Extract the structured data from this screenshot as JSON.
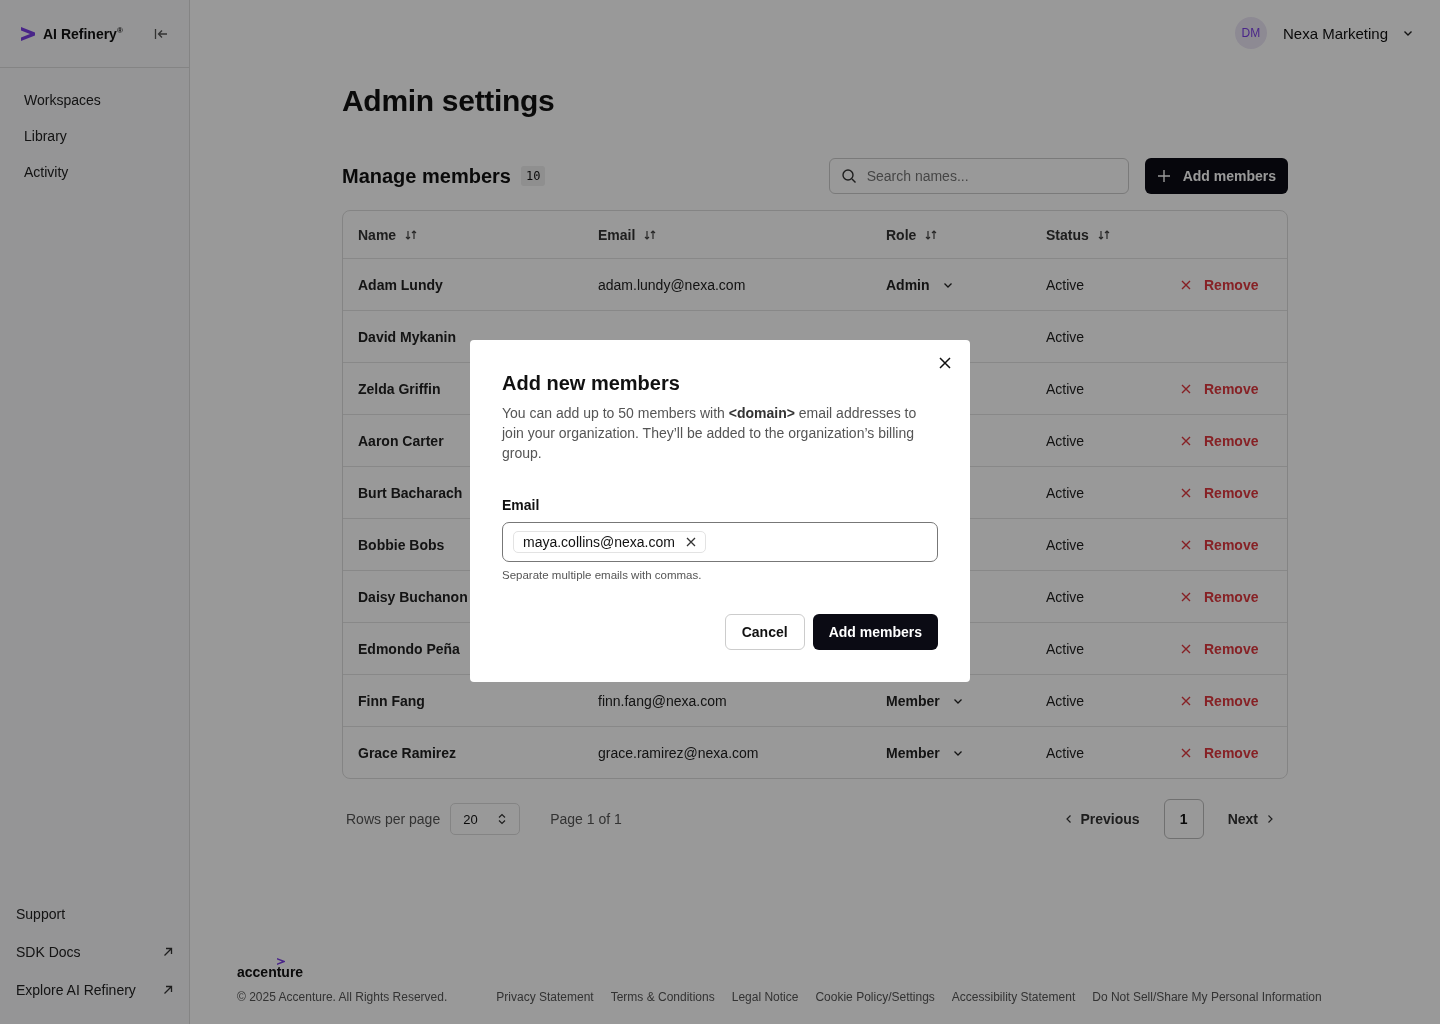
{
  "sidebar": {
    "logo": "AI Refinery$^{®}$",
    "nav": [
      {
        "label": "Workspaces"
      },
      {
        "label": "Library"
      },
      {
        "label": "Activity"
      }
    ],
    "bottom_links": [
      {
        "label": "Support",
        "external": false
      },
      {
        "label": "SDK Docs",
        "external": true
      },
      {
        "label": "Explore AI Refinery",
        "external": true
      }
    ]
  },
  "header": {
    "avatar_initials": "DM",
    "org": "Nexa Marketing"
  },
  "page_title": "Admin settings",
  "members": {
    "title": "Manage members",
    "count": "10",
    "search": {
      "placeholder": "Search names..."
    },
    "add_button": "Add members",
    "columns": [
      "Name",
      "Email",
      "Role",
      "Status"
    ],
    "rows": [
      {
        "name": "Adam Lundy",
        "email": "adam.lundy@nexa.com",
        "role": "Admin",
        "status": "Active",
        "remove": "Remove"
      },
      {
        "name": "David Mykanin",
        "status": "Active"
      },
      {
        "name": "Zelda Griffin",
        "status": "Active",
        "remove": "Remove"
      },
      {
        "name": "Aaron Carter",
        "status": "Active",
        "remove": "Remove"
      },
      {
        "name": "Burt Bacharach",
        "status": "Active",
        "remove": "Remove"
      },
      {
        "name": "Bobbie Bobs",
        "status": "Active",
        "remove": "Remove"
      },
      {
        "name": "Daisy Buchanon",
        "status": "Active",
        "remove": "Remove"
      },
      {
        "name": "Edmondo Peña",
        "status": "Active",
        "remove": "Remove"
      },
      {
        "name": "Finn Fang",
        "email": "finn.fang@nexa.com",
        "role": "Member",
        "status": "Active",
        "remove": "Remove"
      },
      {
        "name": "Grace Ramirez",
        "email": "grace.ramirez@nexa.com",
        "role": "Member",
        "status": "Active",
        "remove": "Remove"
      }
    ],
    "pagination": {
      "rows_label": "Rows per page",
      "rows_value": "20",
      "page_info": "Page 1 of 1",
      "previous": "Previous",
      "pages": [
        {
          "label": "1",
          "selected": true
        }
      ],
      "next": "Next"
    }
  },
  "footer": {
    "brand": "accenture",
    "copyright": "© 2025 Accenture. All Rights Reserved.",
    "links": [
      "Privacy Statement",
      "Terms & Conditions",
      "Legal Notice",
      "Cookie Policy/Settings",
      "Accessibility Statement",
      "Do Not Sell/Share My Personal Information"
    ]
  },
  "modal": {
    "title": "Add new members",
    "description": "You can add up to 50 members with **<domain>** email addresses to join your organization. They’ll be added to the organization’s billing group.",
    "email_label": "Email",
    "chips": [
      "maya.collins@nexa.com"
    ],
    "helper": "Separate multiple emails with commas.",
    "cancel": "Cancel",
    "submit": "Add members"
  }
}
